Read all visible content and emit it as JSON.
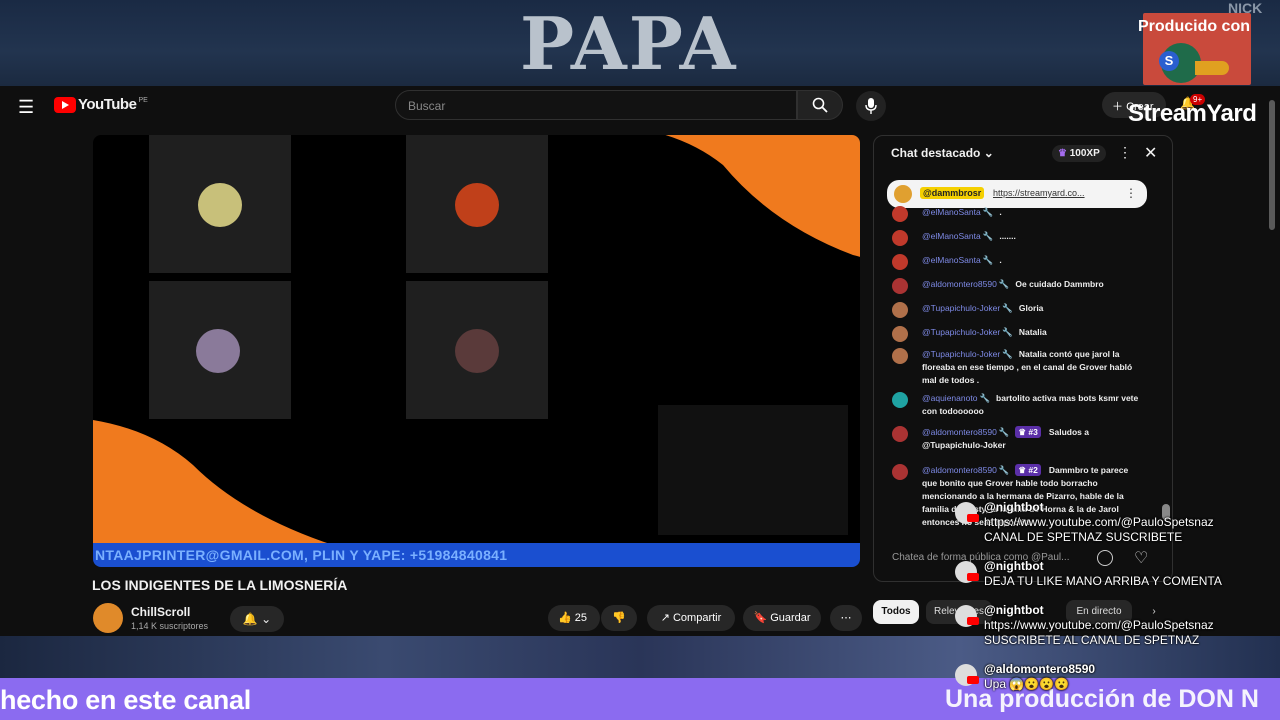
{
  "overlay": {
    "banner_text": "PAPA",
    "banner_small": "NICK",
    "produced_with": "Producido con",
    "stream_brand": "StreamYard",
    "bottom_left_text": "hecho en este canal",
    "bottom_right_text": "Una producción de DON N",
    "messages": [
      {
        "name": "@nightbot",
        "text": "https://www.youtube.com/@PauloSpetsnaz",
        "text2": "CANAL DE SPETNAZ SUSCRIBETE"
      },
      {
        "name": "@nightbot",
        "text": "DEJA TU LIKE MANO ARRIBA Y COMENTA",
        "text2": ""
      },
      {
        "name": "@nightbot",
        "text": "https://www.youtube.com/@PauloSpetsnaz",
        "text2": "SUSCRIBETE AL CANAL DE SPETNAZ"
      },
      {
        "name": "@aldomontero8590",
        "text": "Upa 😱😮😮😮",
        "text2": ""
      }
    ]
  },
  "youtube": {
    "logo_text": "YouTube",
    "region": "PE",
    "search_placeholder": "Buscar",
    "create_label": "Crear",
    "notif_count": "9+"
  },
  "video": {
    "ticker_text": "NTAAJPRINTER@GMAIL.COM, PLIN Y YAPE: +51984840841",
    "title": "LOS INDIGENTES DE LA LIMOSNERÍA",
    "channel": "ChillScroll",
    "subscribers": "1,14 K suscriptores",
    "likes": "25",
    "share_label": "Compartir",
    "save_label": "Guardar"
  },
  "chat": {
    "header": "Chat destacado",
    "xp": "100XP",
    "pinned_user": "@dammbrosr",
    "pinned_link": "https://streamyard.co...",
    "messages": [
      {
        "user": "@elManoSanta",
        "text": ".",
        "color": "#c0392b"
      },
      {
        "user": "@elManoSanta",
        "text": ".......",
        "color": "#c0392b"
      },
      {
        "user": "@elManoSanta",
        "text": ".",
        "color": "#c0392b"
      },
      {
        "user": "@aldomontero8590",
        "text": "Oe cuidado Dammbro",
        "color": "#a33"
      },
      {
        "user": "@Tupapichulo-Joker",
        "text": "Gloria",
        "color": "#b0704a"
      },
      {
        "user": "@Tupapichulo-Joker",
        "text": "Natalia",
        "color": "#b0704a"
      },
      {
        "user": "@Tupapichulo-Joker",
        "text": "Natalia contó que jarol la floreaba en ese tiempo , en el canal de Grover habló mal de todos .",
        "color": "#b0704a"
      },
      {
        "user": "@aquienanoto",
        "text": "bartolito activa mas bots ksmr vete con todoooooo",
        "color": "#1fa3a3"
      },
      {
        "user": "@aldomontero8590",
        "rank": "#3",
        "text": "Saludos a @Tupapichulo-Joker",
        "color": "#a33"
      },
      {
        "user": "@aldomontero8590",
        "rank": "#2",
        "text": "Dammbro te parece que bonito que Grover hable todo borracho mencionando a la hermana de Pizarro, hable de la familia de Pasty, la familia de Horna & la de Jarol entonces no seas hipócrita",
        "color": "#a33"
      }
    ],
    "input_placeholder": "Chatea de forma pública como @Paul...",
    "filters": [
      "Todos",
      "Relevantes",
      "En directo"
    ]
  }
}
